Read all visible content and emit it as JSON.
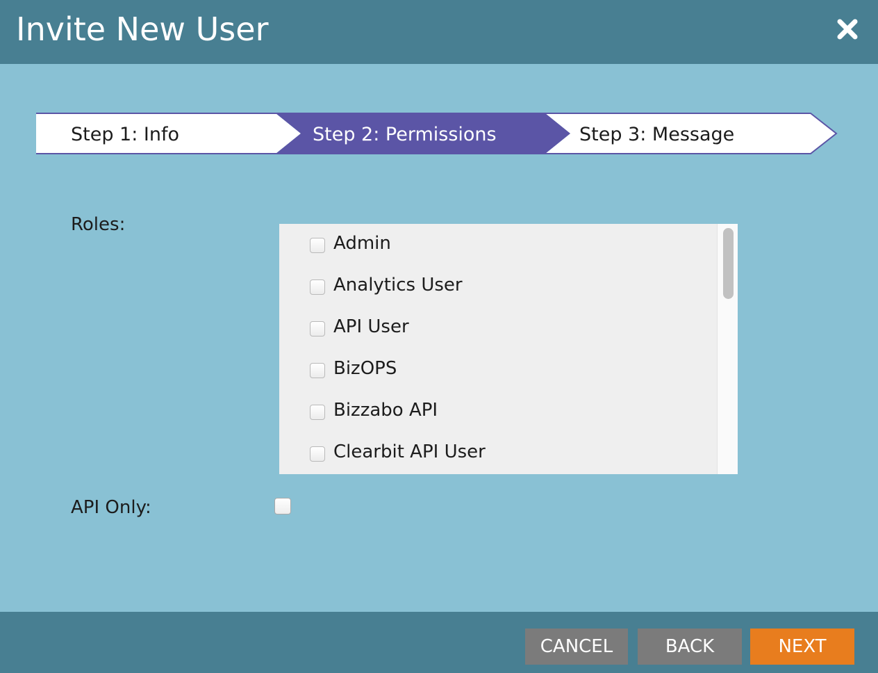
{
  "dialog": {
    "title": "Invite New User",
    "close_icon": "close-icon"
  },
  "wizard": {
    "steps": [
      {
        "label": "Step 1: Info",
        "active": false
      },
      {
        "label": "Step 2: Permissions",
        "active": true
      },
      {
        "label": "Step 3: Message",
        "active": false
      }
    ],
    "active_color": "#5b55a6",
    "border_color": "#5b55a6"
  },
  "form": {
    "roles_label": "Roles:",
    "roles": [
      {
        "label": "Admin",
        "checked": false
      },
      {
        "label": "Analytics User",
        "checked": false
      },
      {
        "label": "API User",
        "checked": false
      },
      {
        "label": "BizOPS",
        "checked": false
      },
      {
        "label": "Bizzabo API",
        "checked": false
      },
      {
        "label": "Clearbit API User",
        "checked": false
      }
    ],
    "api_only_label": "API Only:",
    "api_only_checked": false
  },
  "footer": {
    "cancel_label": "CANCEL",
    "back_label": "BACK",
    "next_label": "NEXT",
    "next_color": "#e87d1e"
  },
  "colors": {
    "header_bg": "#487f92",
    "body_bg": "#89c1d4"
  }
}
